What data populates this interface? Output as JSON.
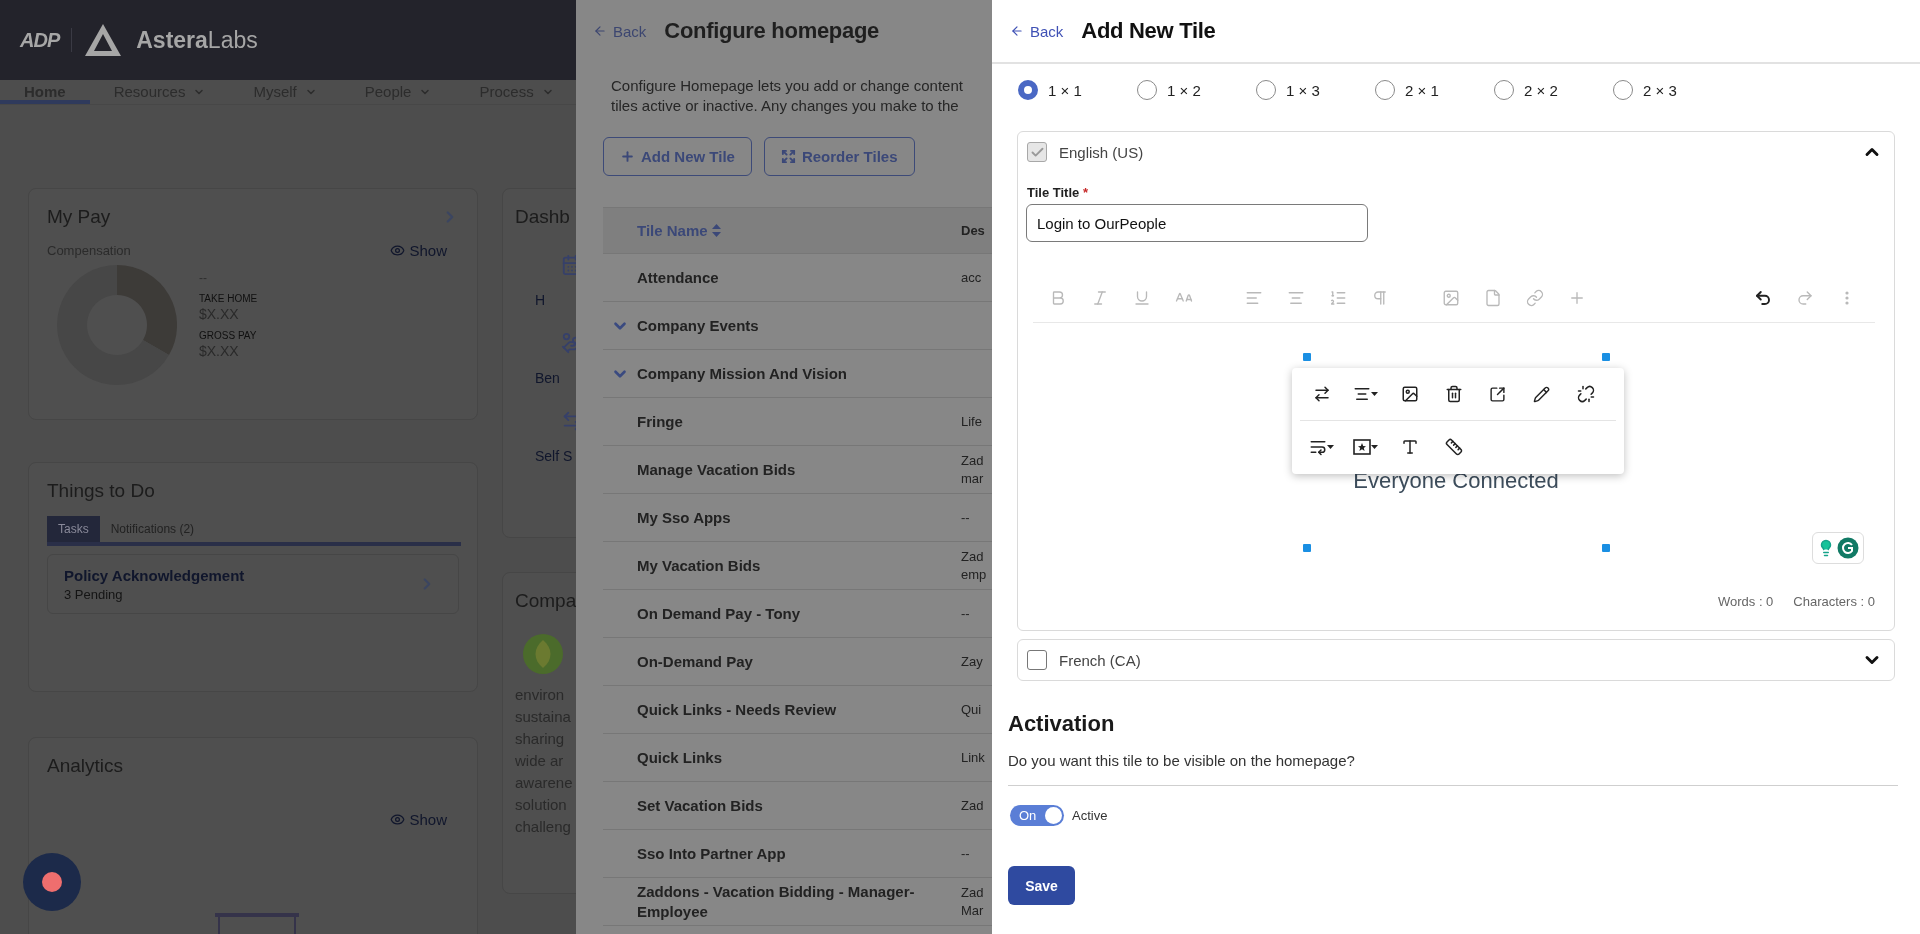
{
  "home": {
    "header": {
      "logo": "ADP",
      "brand": "**Astera**Labs"
    },
    "nav": [
      {
        "label": "Home",
        "selected": true,
        "menu": false
      },
      {
        "label": "Resources",
        "selected": false,
        "menu": true
      },
      {
        "label": "Myself",
        "selected": false,
        "menu": true
      },
      {
        "label": "People",
        "selected": false,
        "menu": true
      },
      {
        "label": "Process",
        "selected": false,
        "menu": true
      }
    ],
    "my_pay": {
      "title": "My Pay",
      "subtitle": "Compensation",
      "show": "Show",
      "amount": "--",
      "figures": [
        {
          "label": "TAKE HOME",
          "value": "$X.XX"
        },
        {
          "label": "GROSS PAY",
          "value": "$X.XX"
        }
      ]
    },
    "dashboard": {
      "title": "Dashb",
      "links": [
        "H",
        "Ben",
        "Self S"
      ]
    },
    "things_to_do": {
      "title": "Things to Do",
      "tabs": [
        {
          "label": "Tasks",
          "selected": true
        },
        {
          "label": "Notifications (2)",
          "selected": false
        }
      ],
      "tasks": [
        {
          "title": "Policy Acknowledgement",
          "subtitle": "3 Pending"
        }
      ]
    },
    "analytics": {
      "title": "Analytics",
      "show": "Show"
    },
    "company": {
      "title": "Compa",
      "text_lines": [
        "environ",
        "sustaina",
        "sharing",
        "wide ar",
        "awarene",
        "solution",
        "challeng"
      ]
    }
  },
  "configure": {
    "back": "Back",
    "title": "Configure homepage",
    "description_lines": [
      "Configure Homepage lets you add or change content",
      "tiles active or inactive. Any changes you make to the"
    ],
    "buttons": [
      "Add New Tile",
      "Reorder Tiles"
    ],
    "columns": [
      "Tile Name",
      "Des"
    ],
    "rows": [
      {
        "kind": "tile",
        "name": "Attendance",
        "description": "acc"
      },
      {
        "kind": "group",
        "name": "Company Events",
        "expanded": false
      },
      {
        "kind": "group",
        "name": "Company Mission And Vision",
        "expanded": false
      },
      {
        "kind": "tile",
        "name": "Fringe",
        "description": "Life"
      },
      {
        "kind": "tile",
        "name": "Manage Vacation Bids",
        "description": "Zad mar"
      },
      {
        "kind": "tile",
        "name": "My Sso Apps",
        "description": "--"
      },
      {
        "kind": "tile",
        "name": "My Vacation Bids",
        "description": "Zad emp"
      },
      {
        "kind": "tile",
        "name": "On Demand Pay - Tony",
        "description": "--"
      },
      {
        "kind": "tile",
        "name": "On-Demand Pay",
        "description": "Zay"
      },
      {
        "kind": "tile",
        "name": "Quick Links - Needs Review",
        "description": "Qui"
      },
      {
        "kind": "tile",
        "name": "Quick Links",
        "description": "Link"
      },
      {
        "kind": "tile",
        "name": "Set Vacation Bids",
        "description": "Zad"
      },
      {
        "kind": "tile",
        "name": "Sso Into Partner App",
        "description": "--"
      },
      {
        "kind": "tile",
        "name": "Zaddons - Vacation Bidding - Manager-Employee",
        "description": "Zad Mar"
      }
    ]
  },
  "add_tile": {
    "back": "Back",
    "title": "Add New Tile",
    "sizes": [
      {
        "label": "1 × 1",
        "selected": true
      },
      {
        "label": "1 × 2",
        "selected": false
      },
      {
        "label": "1 × 3",
        "selected": false
      },
      {
        "label": "2 × 1",
        "selected": false
      },
      {
        "label": "2 × 2",
        "selected": false
      },
      {
        "label": "2 × 3",
        "selected": false
      }
    ],
    "languages": [
      {
        "label": "English (US)",
        "checked": true,
        "disabled": true,
        "expanded": true,
        "field_label": "Tile Title",
        "required_mark": "*",
        "value": "Login to OurPeople",
        "image_caption": "Everyone Connected",
        "toolbar": [
          {
            "disabled": true
          },
          {
            "disabled": true
          },
          {
            "disabled": true
          },
          {
            "disabled": true
          },
          {
            "disabled": true
          },
          {
            "disabled": true
          },
          {
            "disabled": true
          },
          {
            "disabled": true
          },
          {
            "disabled": true
          },
          {
            "disabled": true
          },
          {
            "disabled": true
          },
          {
            "disabled": true
          },
          {
            "disabled": false
          },
          {
            "disabled": true
          },
          {
            "disabled": true
          }
        ],
        "words": "Words : 0",
        "characters": "Characters : 0"
      },
      {
        "label": "French (CA)",
        "checked": false,
        "disabled": false,
        "expanded": false
      }
    ],
    "activation": {
      "title": "Activation",
      "question": "Do you want this tile to be visible on the homepage?",
      "toggle": {
        "on": true,
        "label": "On"
      },
      "status": "Active"
    },
    "save": "Save"
  }
}
